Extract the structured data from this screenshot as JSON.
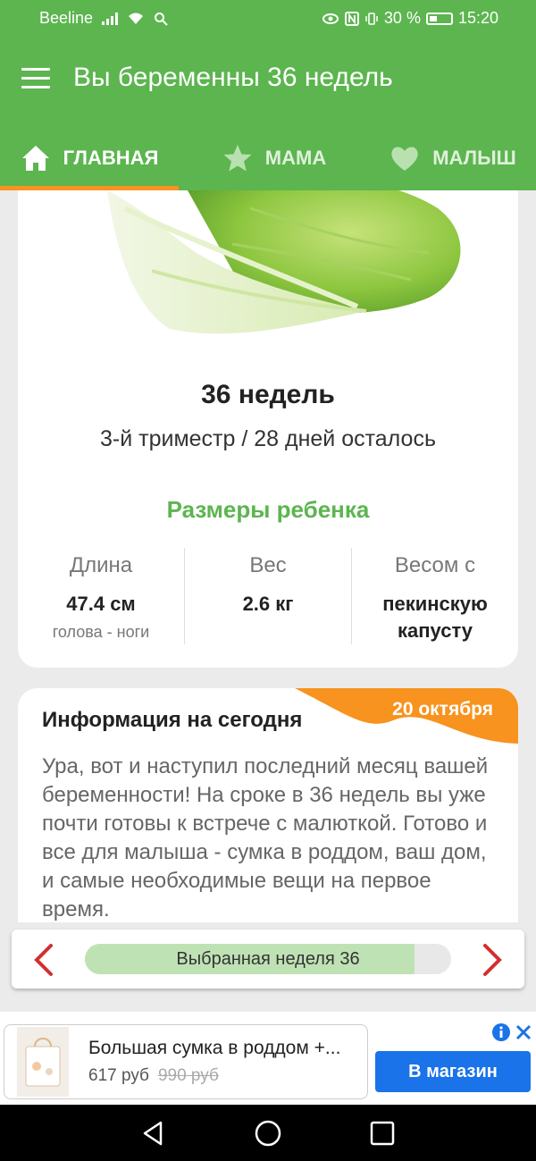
{
  "status_bar": {
    "carrier": "Beeline",
    "battery_percent": "30 %",
    "time": "15:20",
    "icons": [
      "signal-icon",
      "wifi-icon",
      "search-icon",
      "eye-icon",
      "nfc-icon",
      "vibrate-icon",
      "battery-icon"
    ]
  },
  "app_bar": {
    "title": "Вы беременны 36 недель",
    "menu_icon": "menu-icon"
  },
  "tabs": [
    {
      "label": "ГЛАВНАЯ",
      "icon": "home-icon",
      "active": true
    },
    {
      "label": "МАМА",
      "icon": "star-icon",
      "active": false
    },
    {
      "label": "МАЛЫШ",
      "icon": "heart-icon",
      "active": false
    }
  ],
  "summary": {
    "weeks": "36 недель",
    "trimester": "3-й триместр / 28 дней осталось",
    "sizes_title": "Размеры ребенка",
    "stats": [
      {
        "label": "Длина",
        "value": "47.4 см",
        "sub": "голова - ноги"
      },
      {
        "label": "Вес",
        "value": "2.6 кг",
        "sub": ""
      },
      {
        "label": "Весом с",
        "value": "пекинскую капусту",
        "sub": ""
      }
    ]
  },
  "info": {
    "title": "Информация на сегодня",
    "date": "20 октября",
    "text": "Ура, вот и наступил последний месяц вашей беременности! На сроке в 36 недель вы уже почти готовы к встрече с малюткой. Готово и все для малыша - сумка в роддом, ваш дом, и самые необходимые вещи на первое время."
  },
  "week_selector": {
    "label": "Выбранная неделя 36",
    "progress_fraction": 0.9
  },
  "ad": {
    "title": "Большая сумка в роддом +...",
    "price": "617 руб",
    "old_price": "990 руб",
    "button": "В магазин"
  },
  "colors": {
    "brand_green": "#5cb54f",
    "accent_orange": "#f7931e",
    "ad_blue": "#1a73e8",
    "arrow_red": "#d32f2f"
  }
}
